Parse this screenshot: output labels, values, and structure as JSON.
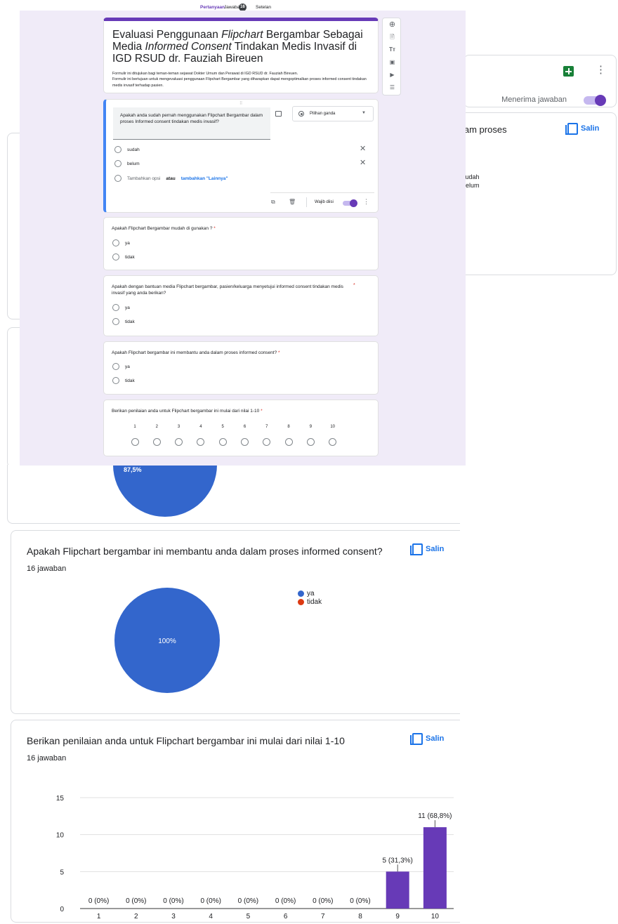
{
  "responses": {
    "summary": {
      "accepting_label": "Menerima jawaban",
      "accepting_on": true
    },
    "q1": {
      "title_partial": "lam proses",
      "legend_sudah": "sudah",
      "legend_belum": "pelum",
      "pie_label": "87,5%"
    },
    "q4": {
      "title": "Apakah Flipchart bergambar ini membantu anda dalam proses informed consent?",
      "count_label": "16 jawaban",
      "legend": [
        {
          "label": "ya",
          "color": "#3366cc"
        },
        {
          "label": "tidak",
          "color": "#dc3912"
        }
      ],
      "pie_label": "100%"
    },
    "q5": {
      "title": "Berikan penilaian anda untuk Flipchart bergambar ini mulai dari nilai 1-10",
      "count_label": "16 jawaban"
    },
    "copy_label": "Salin"
  },
  "tabs": {
    "questions": "Pertanyaan",
    "responses": "Jawaban",
    "responses_count": "16",
    "settings": "Setelan"
  },
  "form": {
    "title_parts": {
      "p1": "Evaluasi Penggunaan ",
      "p2": "Flipchart",
      "p3": " Bergambar Sebagai Media ",
      "p4": "Informed Consent",
      "p5": " Tindakan Medis Invasif di IGD RSUD dr. Fauziah Bireuen"
    },
    "description_1": "Formulir ini ditujukan bagi teman-teman sejawat Dokter Umum dan Perawat di IGD RSUD dr. Fauziah Bireuen.",
    "description_2": "Formulir ini bertujuan untuk mengevaluasi penggunaan Flipchart Bergambar yang diharapkan dapat mengoptimalkan proses informed consent tindakan medis invasif terhadap pasien.",
    "active_question": {
      "text": "Apakah anda sudah pernah menggunakan Flipchart Bergambar dalam proses Informed consent tindakan medis invasif?",
      "type_label": "Pilihan ganda",
      "options": [
        "sudah",
        "belum"
      ],
      "add_option": "Tambahkan opsi",
      "or_label": "atau",
      "add_other": "tambahkan \"Lainnya\"",
      "required_label": "Wajib diisi"
    },
    "q2": {
      "text": "Apakah Flipchart Bergambar mudah di gunakan ?",
      "options": [
        "ya",
        "tidak"
      ]
    },
    "q3": {
      "text": "Apakah dengan bantuan media Flipchart bergambar,  pasien/keluarga menyetujui informed consent tindakan medis invasif yang anda berikan?",
      "options": [
        "ya",
        "tidak"
      ]
    },
    "q4": {
      "text": "Apakah Flipchart bergambar ini membantu anda dalam proses informed consent?",
      "options": [
        "ya",
        "tidak"
      ]
    },
    "q5": {
      "text": "Berikan penilaian anda untuk Flipchart bergambar ini mulai dari nilai 1-10",
      "scale": [
        "1",
        "2",
        "3",
        "4",
        "5",
        "6",
        "7",
        "8",
        "9",
        "10"
      ]
    },
    "required_mark": "*"
  },
  "toolbar_icons": [
    "add-question-icon",
    "import-question-icon",
    "add-title-icon",
    "add-image-icon",
    "add-video-icon",
    "add-section-icon"
  ],
  "chart_data": [
    {
      "type": "pie",
      "title": "Apakah Flipchart bergambar ini membantu anda dalam proses informed consent?",
      "categories": [
        "ya",
        "tidak"
      ],
      "values": [
        16,
        0
      ],
      "labels": [
        "100%"
      ],
      "colors": [
        "#3366cc",
        "#dc3912"
      ],
      "legend": "right"
    },
    {
      "type": "bar",
      "title": "Berikan penilaian anda untuk Flipchart bergambar ini mulai dari nilai 1-10",
      "categories": [
        "1",
        "2",
        "3",
        "4",
        "5",
        "6",
        "7",
        "8",
        "9",
        "10"
      ],
      "values": [
        0,
        0,
        0,
        0,
        0,
        0,
        0,
        0,
        5,
        11
      ],
      "value_labels": [
        "0 (0%)",
        "0 (0%)",
        "0 (0%)",
        "0 (0%)",
        "0 (0%)",
        "0 (0%)",
        "0 (0%)",
        "0 (0%)",
        "5 (31,3%)",
        "11 (68,8%)"
      ],
      "yticks": [
        0,
        5,
        10,
        15
      ],
      "ylim": [
        0,
        15
      ],
      "color": "#673ab7",
      "grid": true
    }
  ]
}
